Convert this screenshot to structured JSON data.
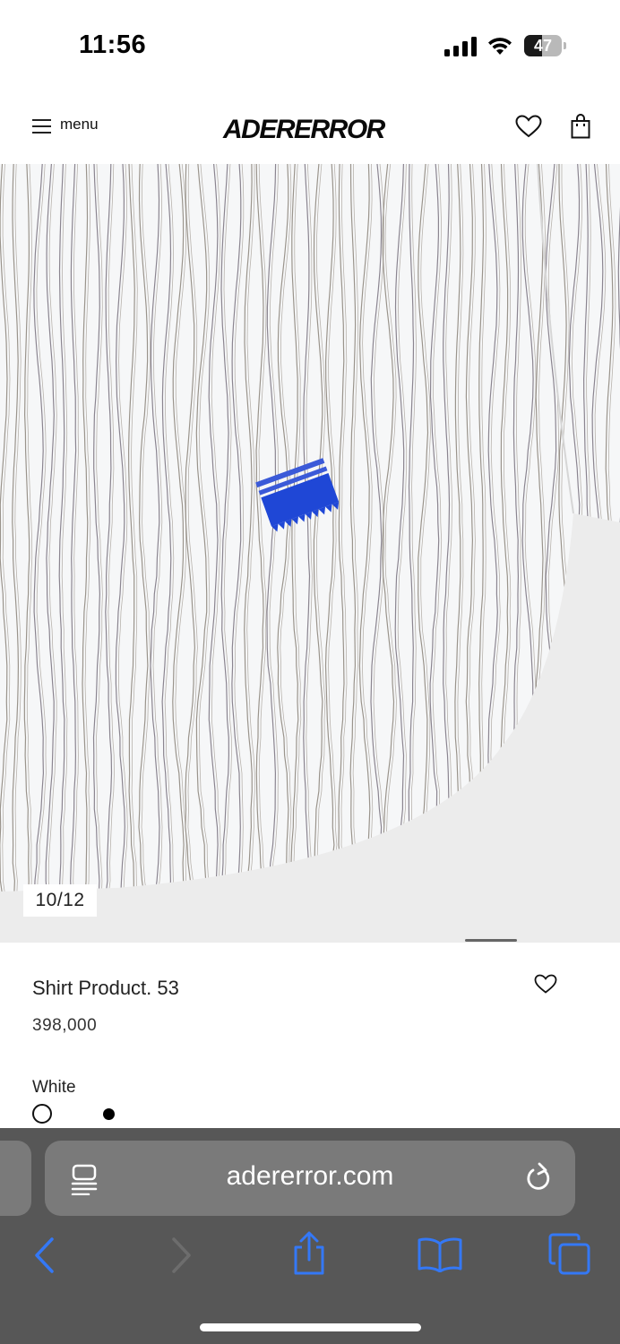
{
  "status_bar": {
    "time": "11:56",
    "battery_level": "47",
    "battery_fraction": 0.47
  },
  "header": {
    "menu_label": "menu",
    "logo_text": "ADERERROR"
  },
  "gallery": {
    "counter": "10/12",
    "current": 10,
    "total": 12
  },
  "product": {
    "name": "Shirt Product. 53",
    "price": "398,000",
    "color_label": "White",
    "colors": [
      "White",
      "Black"
    ],
    "selected_color": "White"
  },
  "browser": {
    "url": "adererror.com",
    "accent_color": "#3478f6"
  }
}
